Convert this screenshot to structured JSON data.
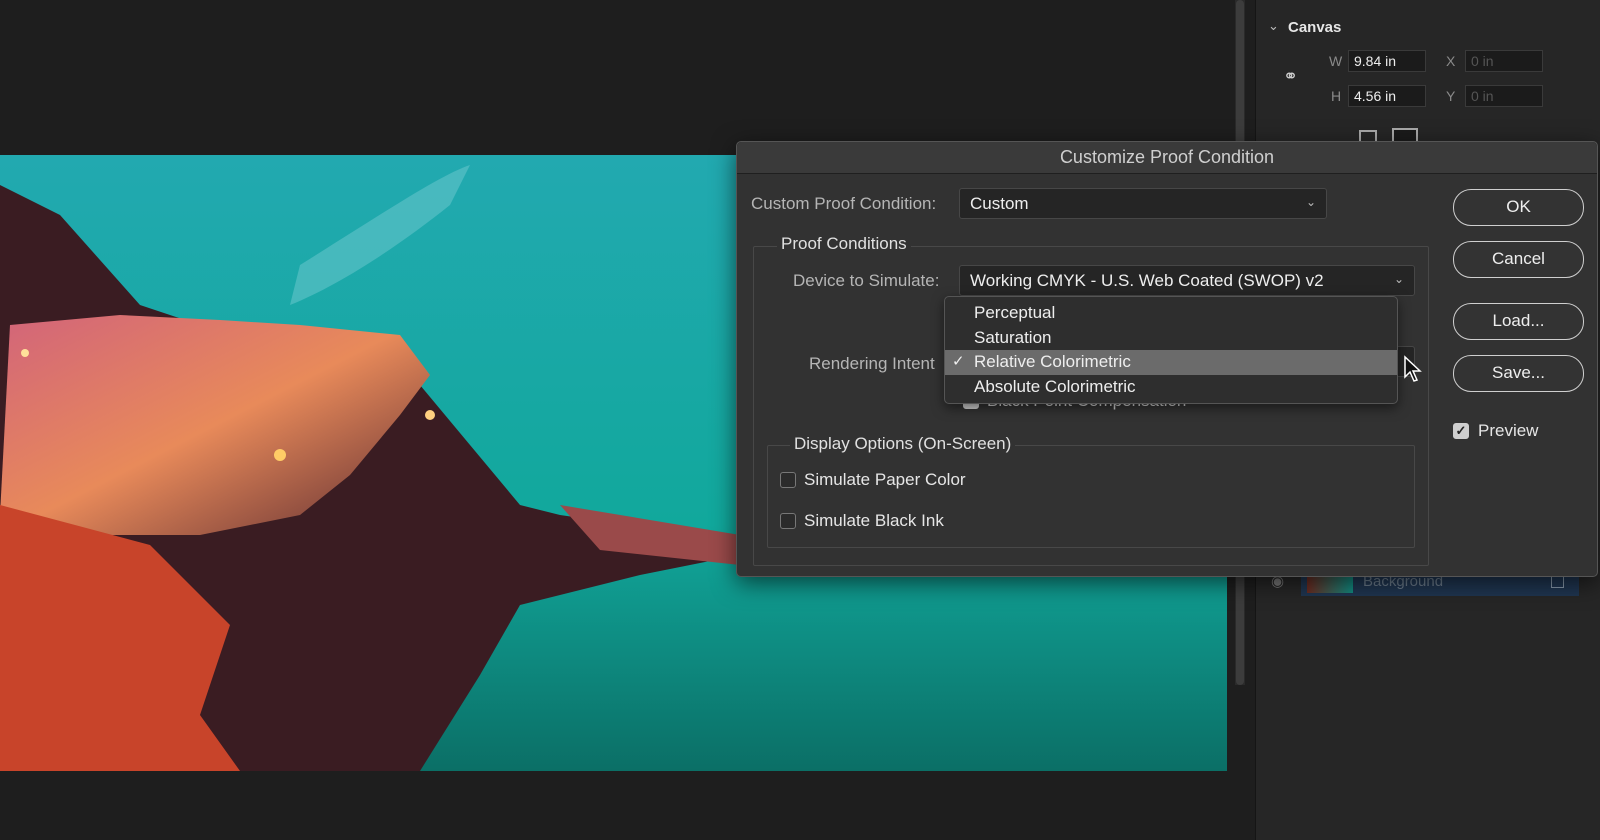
{
  "properties_panel": {
    "section_title": "Canvas",
    "w_label": "W",
    "w_value": "9.84 in",
    "h_label": "H",
    "h_value": "4.56 in",
    "x_label": "X",
    "x_value": "0 in",
    "y_label": "Y",
    "y_value": "0 in",
    "icons": [
      "chevron-down-icon",
      "link-icon",
      "portrait-icon",
      "landscape-icon"
    ]
  },
  "layers_panel": {
    "layer_name": "Background",
    "icons": [
      "eye-icon",
      "lock-icon"
    ]
  },
  "dialog": {
    "title": "Customize Proof Condition",
    "custom_label": "Custom Proof Condition:",
    "custom_value": "Custom",
    "proof_group": "Proof Conditions",
    "device_label": "Device to Simulate:",
    "device_value": "Working CMYK - U.S. Web Coated (SWOP) v2",
    "intent_label": "Rendering Intent",
    "intent_options": [
      "Perceptual",
      "Saturation",
      "Relative Colorimetric",
      "Absolute Colorimetric"
    ],
    "intent_selected": "Relative Colorimetric",
    "bpc_label": "Black Point Compensation",
    "bpc_checked": true,
    "display_group": "Display Options (On-Screen)",
    "paper_label": "Simulate Paper Color",
    "paper_checked": false,
    "ink_label": "Simulate Black Ink",
    "ink_checked": false,
    "buttons": {
      "ok": "OK",
      "cancel": "Cancel",
      "load": "Load...",
      "save": "Save..."
    },
    "preview_label": "Preview",
    "preview_checked": true
  },
  "colors": {
    "sky": "#1fb3ad",
    "sea": "#0f8a7f",
    "highlight": "#6b6b6b",
    "layer_selected": "#1f3550"
  }
}
